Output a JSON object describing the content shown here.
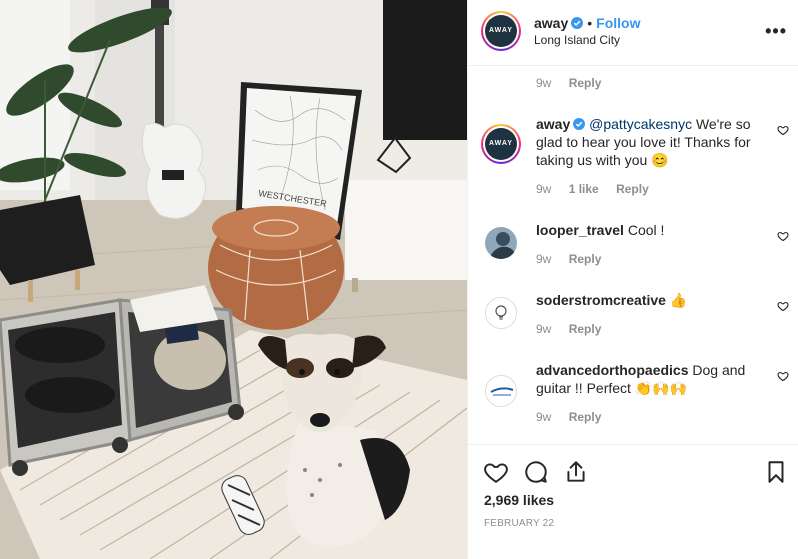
{
  "header": {
    "username": "away",
    "follow_label": "Follow",
    "separator": "•",
    "location": "Long Island City",
    "more_label": "•••",
    "avatar_text": "AWAY"
  },
  "caption_meta": {
    "time": "9w",
    "reply_label": "Reply"
  },
  "comments": [
    {
      "username": "away",
      "mention": "@pattycakesnyc",
      "text": " We're so glad to hear you love it! Thanks for taking us with you 😊",
      "time": "9w",
      "likes": "1 like",
      "reply_label": "Reply",
      "avatar_text": "AWAY"
    },
    {
      "username": "looper_travel",
      "text": " Cool !",
      "time": "9w",
      "reply_label": "Reply"
    },
    {
      "username": "soderstromcreative",
      "text": " 👍",
      "time": "9w",
      "reply_label": "Reply"
    },
    {
      "username": "advancedorthopaedics",
      "text": " Dog and guitar !! Perfect 👏🙌🙌",
      "time": "9w",
      "reply_label": "Reply"
    }
  ],
  "photo": {
    "poster_title": "WESTCHESTER"
  },
  "actions": {
    "likes": "2,969 likes",
    "date": "FEBRUARY 22"
  },
  "colors": {
    "accent": "#3897f0",
    "away_navy": "#1f3240",
    "muted": "#8e8e8e",
    "text": "#262626"
  },
  "icons": [
    "verified-badge-icon",
    "more-options-icon",
    "heart-icon",
    "comment-icon",
    "share-icon",
    "bookmark-icon"
  ]
}
